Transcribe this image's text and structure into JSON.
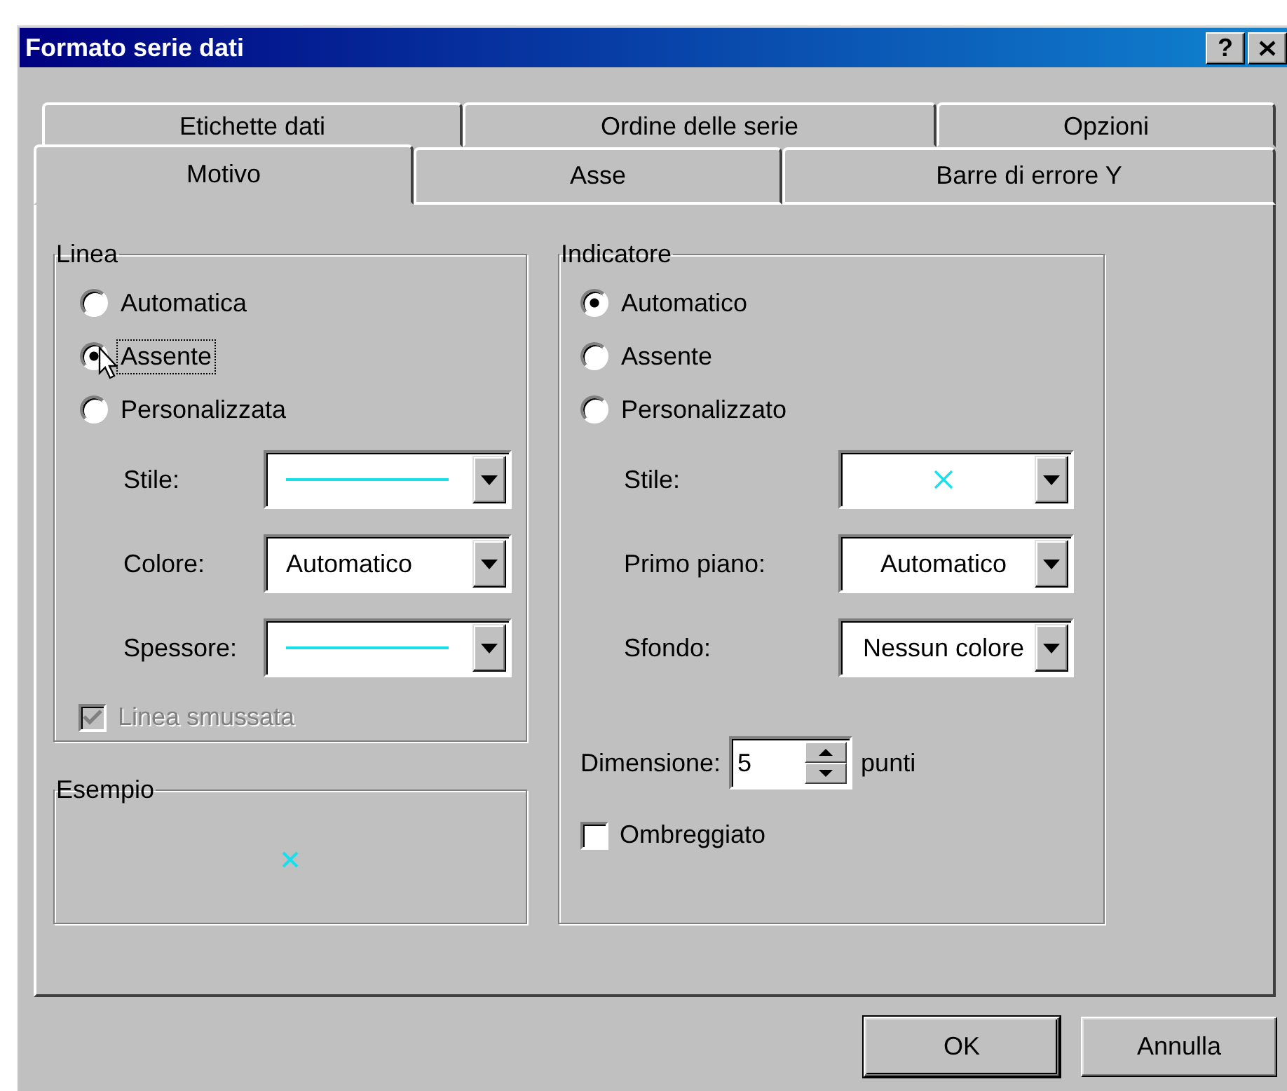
{
  "window": {
    "title": "Formato serie dati",
    "help": "?"
  },
  "tab_rows": [
    [
      {
        "label": "Etichette dati",
        "selected": false
      },
      {
        "label": "Ordine delle serie",
        "selected": false
      },
      {
        "label": "Opzioni",
        "selected": false
      }
    ],
    [
      {
        "label": "Motivo",
        "selected": true
      },
      {
        "label": "Asse",
        "selected": false
      },
      {
        "label": "Barre di errore Y",
        "selected": false
      }
    ]
  ],
  "line": {
    "title": "Linea",
    "options": [
      {
        "label": "Automatica",
        "selected": false,
        "focused": false
      },
      {
        "label": "Assente",
        "selected": true,
        "focused": true
      },
      {
        "label": "Personalizzata",
        "selected": false,
        "focused": false
      }
    ],
    "fields": [
      {
        "label": "Stile:",
        "kind": "line"
      },
      {
        "label": "Colore:",
        "kind": "text",
        "value": "Automatico"
      },
      {
        "label": "Spessore:",
        "kind": "line"
      }
    ],
    "smoothed": {
      "label": "Linea smussata",
      "checked": true,
      "disabled": true
    }
  },
  "sample": {
    "title": "Esempio"
  },
  "marker": {
    "title": "Indicatore",
    "options": [
      {
        "label": "Automatico",
        "selected": true,
        "focused": false
      },
      {
        "label": "Assente",
        "selected": false,
        "focused": false
      },
      {
        "label": "Personalizzato",
        "selected": false,
        "focused": false
      }
    ],
    "fields": [
      {
        "label": "Stile:",
        "kind": "marker"
      },
      {
        "label": "Primo piano:",
        "kind": "text",
        "value": "Automatico"
      },
      {
        "label": "Sfondo:",
        "kind": "text",
        "value": "Nessun colore"
      }
    ],
    "size": {
      "label": "Dimensione:",
      "value": "5",
      "unit": "punti"
    },
    "shadow": {
      "label": "Ombreggiato",
      "checked": false,
      "disabled": false
    }
  },
  "buttons": [
    {
      "label": "OK",
      "default": true
    },
    {
      "label": "Annulla",
      "default": false
    }
  ]
}
